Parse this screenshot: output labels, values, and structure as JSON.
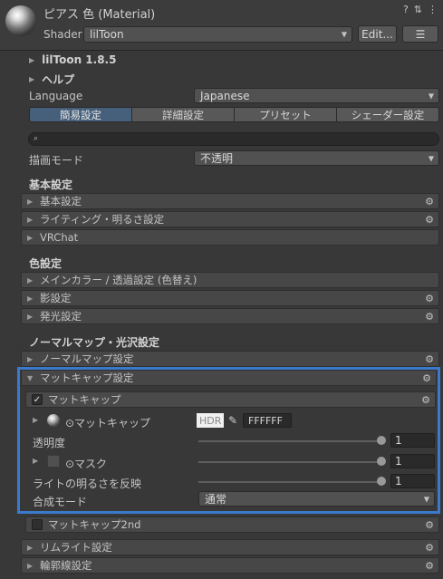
{
  "header": {
    "title": "ピアス 色 (Material)",
    "help_icon": "?",
    "settings_icon": "⇅",
    "menu_icon": "⋮",
    "shader_label": "Shader",
    "shader_value": "lilToon",
    "edit_label": "Edit...",
    "list_icon": "☰"
  },
  "foldouts": {
    "version": "lilToon 1.8.5",
    "help": "ヘルプ"
  },
  "language": {
    "label": "Language",
    "value": "Japanese"
  },
  "tabs": [
    "簡易設定",
    "詳細設定",
    "プリセット",
    "シェーダー設定"
  ],
  "render_mode": {
    "label": "描画モード",
    "value": "不透明"
  },
  "basic": {
    "heading": "基本設定",
    "items": [
      "基本設定",
      "ライティング・明るさ設定",
      "VRChat"
    ]
  },
  "color": {
    "heading": "色設定",
    "items": [
      "メインカラー / 透過設定 (色替え)",
      "影設定",
      "発光設定"
    ]
  },
  "normal": {
    "heading": "ノーマルマップ・光沢設定",
    "items": [
      "ノーマルマップ設定",
      "マットキャップ設定"
    ]
  },
  "matcap": {
    "enable_label": "マットキャップ",
    "enable_checked": "✓",
    "texture_label": "⊙マットキャップ",
    "hdr_label": "HDR",
    "color_value": "FFFFFF",
    "opacity_label": "透明度",
    "opacity_value": "1",
    "mask_label": "⊙マスク",
    "mask_value": "1",
    "light_label": "ライトの明るさを反映",
    "light_value": "1",
    "blend_label": "合成モード",
    "blend_value": "通常"
  },
  "matcap2": {
    "label": "マットキャップ2nd"
  },
  "bottom": {
    "items": [
      "リムライト設定",
      "輪郭線設定"
    ]
  },
  "icons": {
    "gear": "⚙",
    "triangle_right": "▶",
    "triangle_down": "▼",
    "dropdown_arrow": "▼",
    "search": "🔍",
    "eyedropper": "✎"
  },
  "colors": {
    "highlight_border": "#3b79cc",
    "active_tab": "#46607c"
  }
}
